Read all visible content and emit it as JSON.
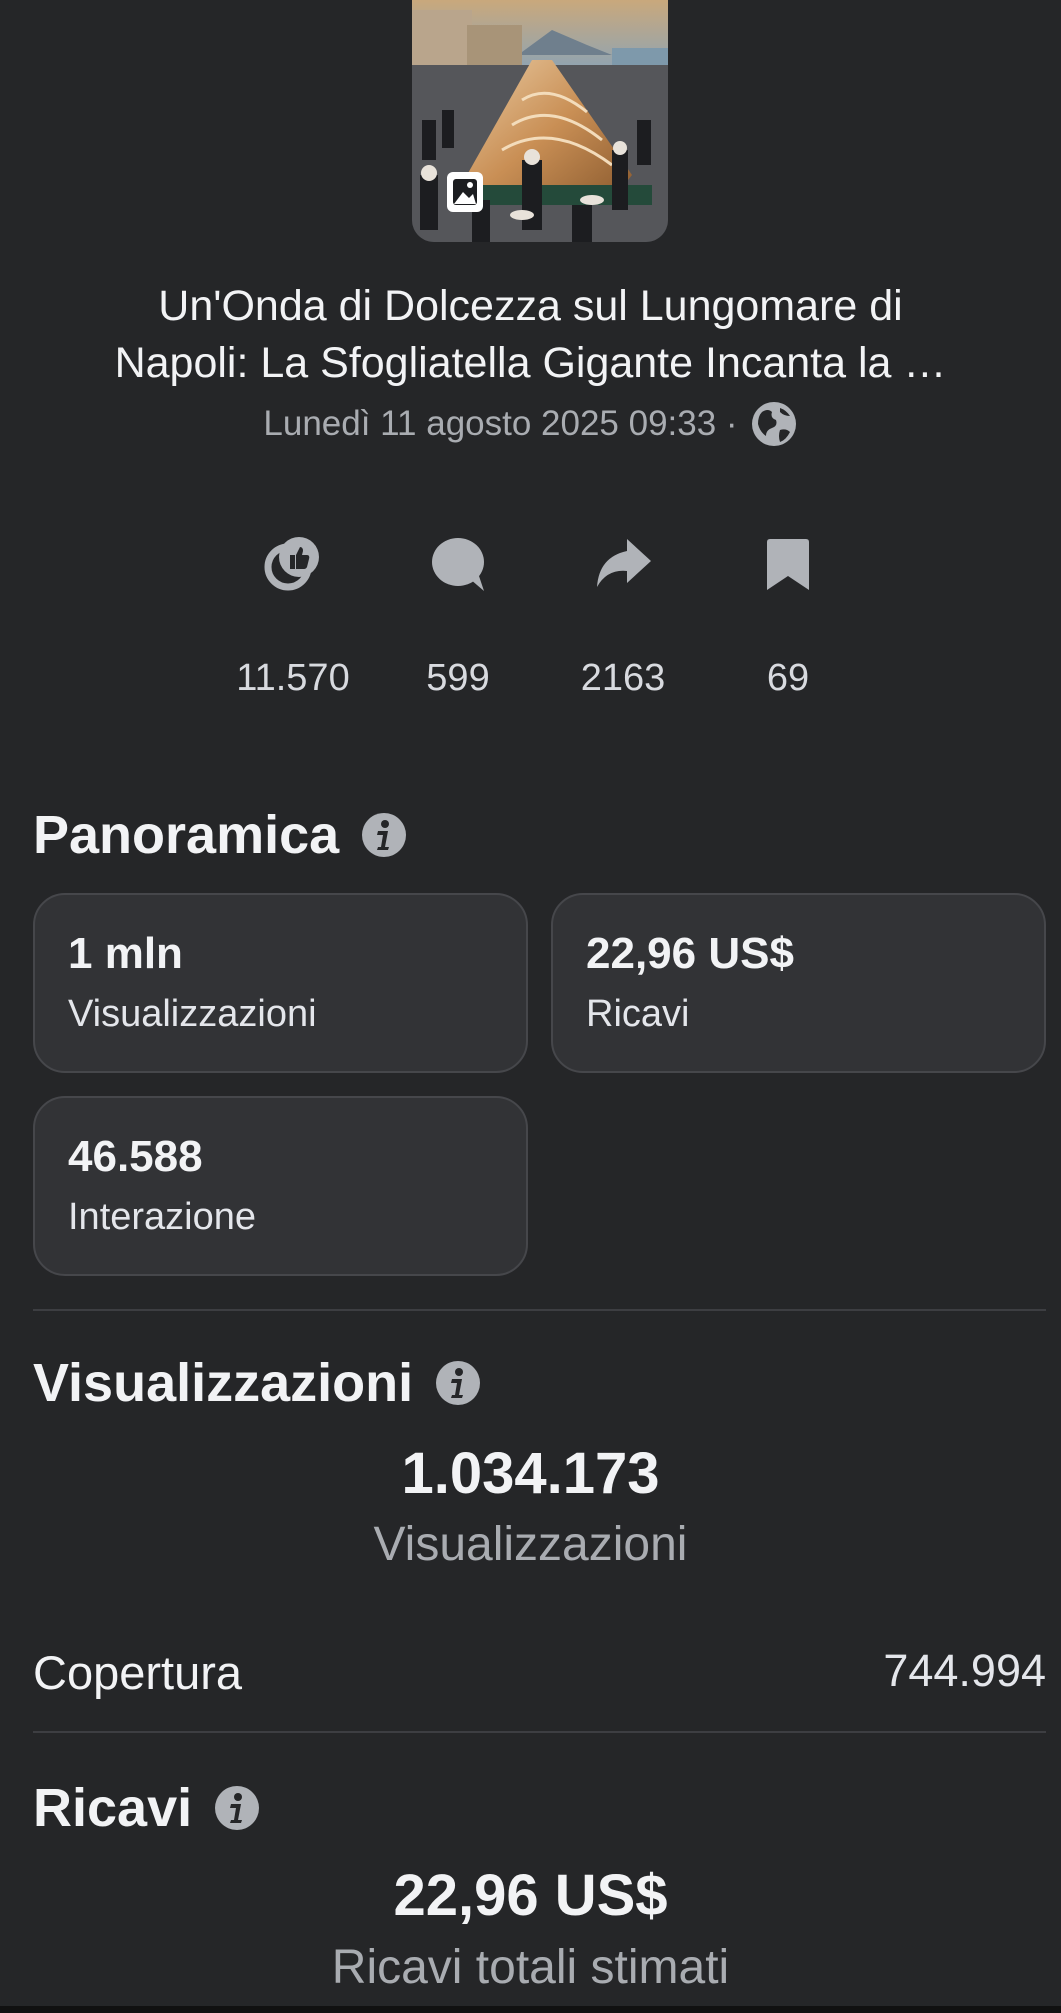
{
  "post": {
    "title_line1": "Un'Onda di Dolcezza sul Lungomare di",
    "title_line2": "Napoli: La Sfogliatella Gigante Incanta la …",
    "date": "Lunedì 11 agosto 2025 09:33 ·",
    "thumbnail_icon": "photo-icon",
    "audience_icon": "globe-icon"
  },
  "stats": [
    {
      "icon": "reactions-icon",
      "value": "11.570"
    },
    {
      "icon": "comment-icon",
      "value": "599"
    },
    {
      "icon": "share-icon",
      "value": "2163"
    },
    {
      "icon": "bookmark-icon",
      "value": "69"
    }
  ],
  "overview": {
    "title": "Panoramica",
    "cards": [
      {
        "value": "1 mln",
        "label": "Visualizzazioni"
      },
      {
        "value": "22,96 US$",
        "label": "Ricavi"
      },
      {
        "value": "46.588",
        "label": "Interazione"
      }
    ]
  },
  "views": {
    "title": "Visualizzazioni",
    "total": "1.034.173",
    "total_label": "Visualizzazioni",
    "reach_label": "Copertura",
    "reach_value": "744.994"
  },
  "revenue": {
    "title": "Ricavi",
    "total": "22,96 US$",
    "total_label": "Ricavi totali stimati"
  },
  "colors": {
    "background": "#252628",
    "card": "#323336",
    "text": "#f2f3f5",
    "muted": "#a9acb1",
    "icon": "#b0b3b8"
  }
}
